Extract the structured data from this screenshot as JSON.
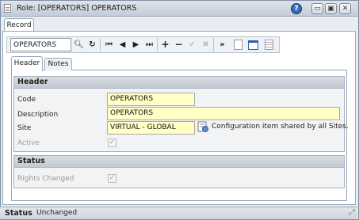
{
  "window": {
    "title": "Role: [OPERATORS] OPERATORS",
    "help_label": "?",
    "min_label": "▭",
    "restore_label": "▣",
    "close_label": "✕"
  },
  "tabs": {
    "record": "Record"
  },
  "toolbar": {
    "search_value": "OPERATORS",
    "icons": [
      "search-icon",
      "refresh-icon",
      "first-record-icon",
      "previous-record-icon",
      "next-record-icon",
      "last-record-icon",
      "add-icon",
      "delete-icon",
      "save-icon",
      "cancel-icon",
      "forward-icon"
    ]
  },
  "subtabs": {
    "header": "Header",
    "notes": "Notes"
  },
  "header_section": {
    "title": "Header",
    "code_label": "Code",
    "code_value": "OPERATORS",
    "description_label": "Description",
    "description_value": "OPERATORS",
    "site_label": "Site",
    "site_value": "VIRTUAL - GLOBAL",
    "site_note": "Configuration item shared by all Sites.",
    "active_label": "Active",
    "active_checked": true
  },
  "status_section": {
    "title": "Status",
    "rights_changed_label": "Rights Changed",
    "rights_changed_checked": true
  },
  "statusbar": {
    "label": "Status",
    "value": "Unchanged"
  },
  "colors": {
    "field_bg": "#ffffc6",
    "section_header": "#c9ced5",
    "accent_blue": "#2a5fa8"
  }
}
